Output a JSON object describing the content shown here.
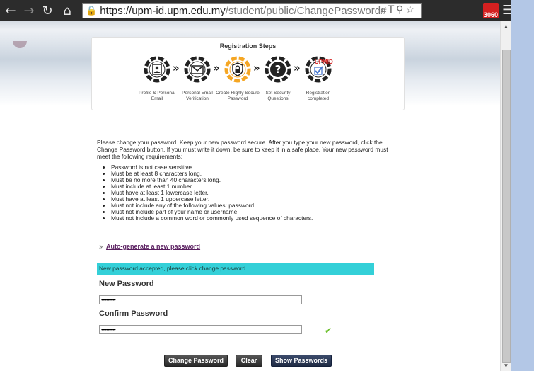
{
  "browser": {
    "url_host": "https://upm-id.upm.edu.my",
    "url_path": "/student/public/ChangePassword#",
    "extension_badge": "3060"
  },
  "steps": {
    "title": "Registration Steps",
    "items": [
      {
        "label": "Profile & Personal Email",
        "icon": "profile-card-icon",
        "active": false
      },
      {
        "label": "Personal Email Verification",
        "icon": "envelope-icon",
        "active": false
      },
      {
        "label": "Create Highly Secure Password",
        "icon": "lock-icon",
        "active": true
      },
      {
        "label": "Set Security Questions",
        "icon": "question-icon",
        "active": false
      },
      {
        "label": "Registration completed",
        "icon": "upmid-check-icon",
        "active": false
      }
    ],
    "logo_text": "UPMID",
    "colors": {
      "active_ring": "#f5a623",
      "ring": "#222222"
    }
  },
  "intro": "Please change your password. Keep your new password secure. After you type your new password, click the Change Password button. If you must write it down, be sure to keep it in a safe place. Your new password must meet the following requirements:",
  "requirements": [
    "Password is not case sensitive.",
    "Must be at least 8 characters long.",
    "Must be no more than 40 characters long.",
    "Must include at least 1 number.",
    "Must have at least 1 lowercase letter.",
    "Must have at least 1 uppercase letter.",
    "Must not include any of the following values: password",
    "Must not include part of your name or username.",
    "Must not include a common word or commonly used sequence of characters."
  ],
  "autogen": {
    "prefix": "»",
    "link": "Auto-generate a new password"
  },
  "status": {
    "message": "New password accepted, please click change password",
    "color": "#34d0d8"
  },
  "form": {
    "new_label": "New Password",
    "new_value": "•••••••••••",
    "confirm_label": "Confirm Password",
    "confirm_value": "•••••••••••"
  },
  "buttons": {
    "change": "Change Password",
    "clear": "Clear",
    "show": "Show Passwords"
  }
}
